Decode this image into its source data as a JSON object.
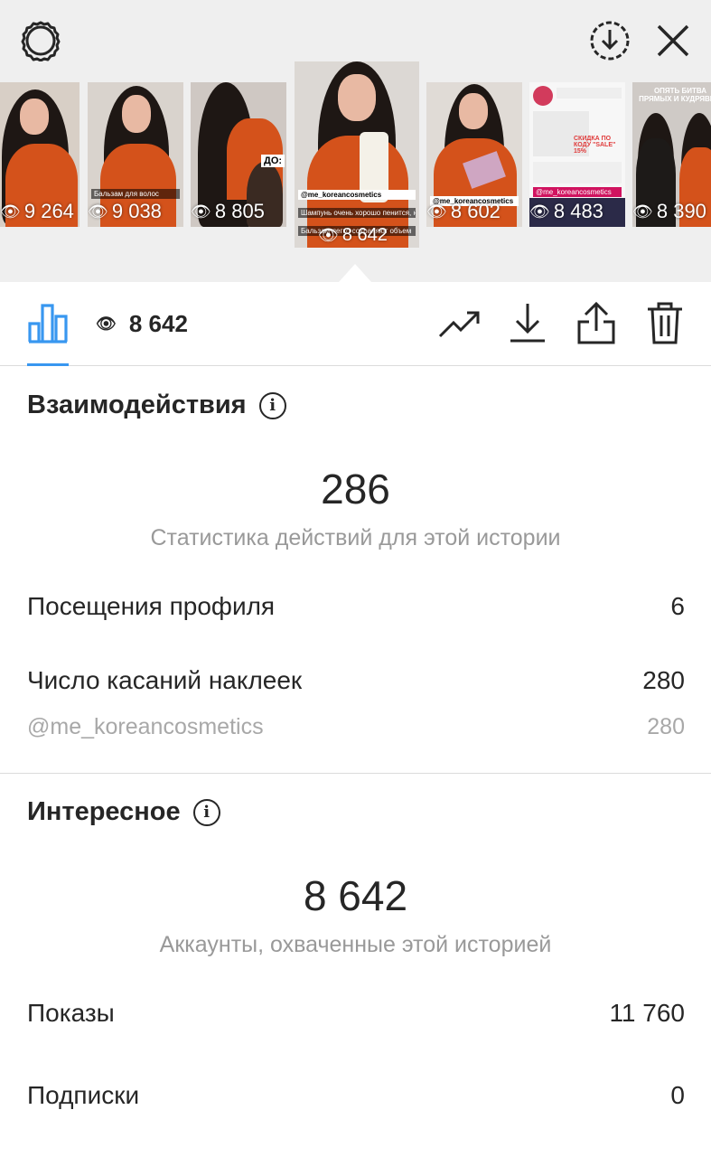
{
  "thumbnails": [
    {
      "views": "9 264",
      "caption": "",
      "selected": false
    },
    {
      "views": "9 038",
      "caption": "Бальзам для волос",
      "selected": false
    },
    {
      "views": "8 805",
      "caption": "ДО:",
      "selected": false
    },
    {
      "views": "8 642",
      "caption": "@me_koreancosmetics",
      "caption2": "Шампунь очень хорошо пенится, на мои волосы нужно совсем немного",
      "caption3": "Бальзам легко сохраняют объем",
      "selected": true
    },
    {
      "views": "8 602",
      "caption": "@me_koreancosmetics",
      "selected": false
    },
    {
      "views": "8 483",
      "caption": "@me_koreancosmetics",
      "promo": "СКИДКА ПО КОДУ \"SALE\" 15%",
      "selected": false
    },
    {
      "views": "8 390",
      "caption": "ОПЯТЬ БИТВА ПРЯМЫХ И КУДРЯВЫХ",
      "selected": false
    }
  ],
  "toolbar": {
    "reach_value": "8 642"
  },
  "interactions": {
    "title": "Взаимодействия",
    "total": "286",
    "subtitle": "Статистика действий для этой истории",
    "rows": [
      {
        "label": "Посещения профиля",
        "value": "6"
      },
      {
        "label": "Число касаний наклеек",
        "value": "280"
      }
    ],
    "sub_row": {
      "label": "@me_koreancosmetics",
      "value": "280"
    }
  },
  "discovery": {
    "title": "Интересное",
    "total": "8 642",
    "subtitle": "Аккаунты, охваченные этой историей",
    "rows": [
      {
        "label": "Показы",
        "value": "11 760"
      },
      {
        "label": "Подписки",
        "value": "0"
      }
    ]
  },
  "colors": {
    "accent": "#3897f0",
    "top_bg": "#efefef",
    "muted": "#999999"
  }
}
